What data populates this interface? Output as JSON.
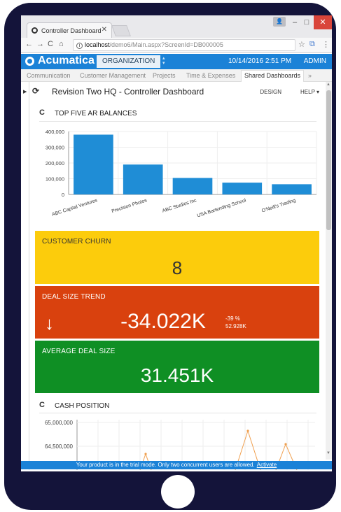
{
  "browser": {
    "tab_title": "Controller Dashboard",
    "url_host": "localhost",
    "url_path": "/demo6/Main.aspx?ScreenId=DB000005"
  },
  "app": {
    "brand": "Acumatica",
    "org_button": "ORGANIZATION",
    "datetime": "10/14/2016  2:51 PM",
    "user": "ADMIN",
    "menu": [
      "Communication",
      "Customer Management",
      "Projects",
      "Time & Expenses",
      "Shared Dashboards"
    ],
    "active_menu": "Shared Dashboards"
  },
  "page": {
    "title": "Revision Two HQ - Controller Dashboard",
    "design_label": "DESIGN",
    "help_label": "HELP ▾"
  },
  "ar_widget": {
    "title": "TOP FIVE AR BALANCES"
  },
  "chart_data": {
    "type": "bar",
    "title": "TOP FIVE AR BALANCES",
    "categories": [
      "ABC Capital Ventures",
      "Precision Photos",
      "ABC Studios Inc",
      "USA Bartending School",
      "O'Neill's Trading"
    ],
    "values": [
      380000,
      190000,
      105000,
      75000,
      65000
    ],
    "yticks": [
      "0",
      "100,000",
      "200,000",
      "300,000",
      "400,000"
    ],
    "ylim": [
      0,
      400000
    ],
    "color": "#1f8dd6",
    "grid": true
  },
  "tiles": {
    "churn": {
      "title": "CUSTOMER CHURN",
      "value": "8",
      "color": "#fccc0c"
    },
    "trend": {
      "title": "DEAL SIZE TREND",
      "value": "-34.022K",
      "arrow": "↓",
      "pct": "-39 %",
      "prev": "52.928K",
      "color": "#d9410e"
    },
    "avg": {
      "title": "AVERAGE DEAL SIZE",
      "value": "31.451K",
      "color": "#0f8f24"
    }
  },
  "cash_widget": {
    "title": "CASH POSITION",
    "yticks": [
      "65,000,000",
      "64,500,000"
    ],
    "line_color": "#f0a050"
  },
  "trial": {
    "message": "Your product is in the trial mode. Only two concurrent users are allowed.",
    "activate": "Activate"
  }
}
